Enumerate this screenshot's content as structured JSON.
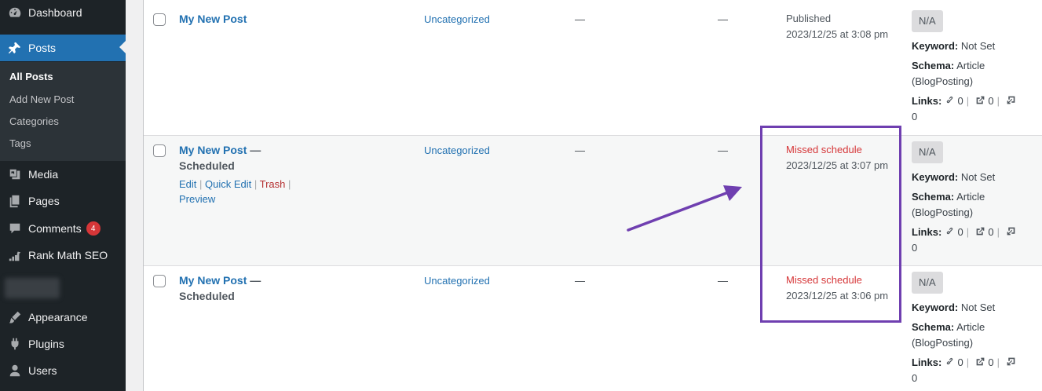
{
  "sidebar": {
    "dashboard": "Dashboard",
    "posts": "Posts",
    "submenu": [
      "All Posts",
      "Add New Post",
      "Categories",
      "Tags"
    ],
    "media": "Media",
    "pages": "Pages",
    "comments": "Comments",
    "comments_badge": "4",
    "rankmath": "Rank Math SEO",
    "appearance": "Appearance",
    "plugins": "Plugins",
    "users": "Users"
  },
  "rows": [
    {
      "title": "My New Post",
      "state": "",
      "category": "Uncategorized",
      "tags": "—",
      "comments": "—",
      "status": "Published",
      "date": "2023/12/25 at 3:08 pm",
      "seo_score": "N/A",
      "keyword_label": "Keyword:",
      "keyword": "Not Set",
      "schema_label": "Schema:",
      "schema": "Article (BlogPosting)",
      "links_label": "Links:",
      "links_internal": "0",
      "links_external": "0",
      "links_incoming": "0"
    },
    {
      "title": "My New Post",
      "state": "— Scheduled",
      "category": "Uncategorized",
      "tags": "—",
      "comments": "—",
      "status": "Missed schedule",
      "date": "2023/12/25 at 3:07 pm",
      "seo_score": "N/A",
      "keyword_label": "Keyword:",
      "keyword": "Not Set",
      "schema_label": "Schema:",
      "schema": "Article (BlogPosting)",
      "links_label": "Links:",
      "links_internal": "0",
      "links_external": "0",
      "links_incoming": "0",
      "actions": {
        "edit": "Edit",
        "quick_edit": "Quick Edit",
        "trash": "Trash",
        "preview": "Preview"
      }
    },
    {
      "title": "My New Post",
      "state": "— Scheduled",
      "category": "Uncategorized",
      "tags": "—",
      "comments": "—",
      "status": "Missed schedule",
      "date": "2023/12/25 at 3:06 pm",
      "seo_score": "N/A",
      "keyword_label": "Keyword:",
      "keyword": "Not Set",
      "schema_label": "Schema:",
      "schema": "Article (BlogPosting)",
      "links_label": "Links:",
      "links_internal": "0",
      "links_external": "0",
      "links_incoming": "0"
    }
  ],
  "colors": {
    "sidebar_bg": "#1d2327",
    "active": "#2271b1",
    "missed": "#d63638",
    "annotation": "#6f3fb0"
  },
  "icons": [
    "dashboard-icon",
    "pin-icon",
    "media-icon",
    "pages-icon",
    "comments-icon",
    "rankmath-icon",
    "appearance-icon",
    "plugins-icon",
    "users-icon",
    "link-icon",
    "external-link-icon",
    "incoming-link-icon"
  ]
}
